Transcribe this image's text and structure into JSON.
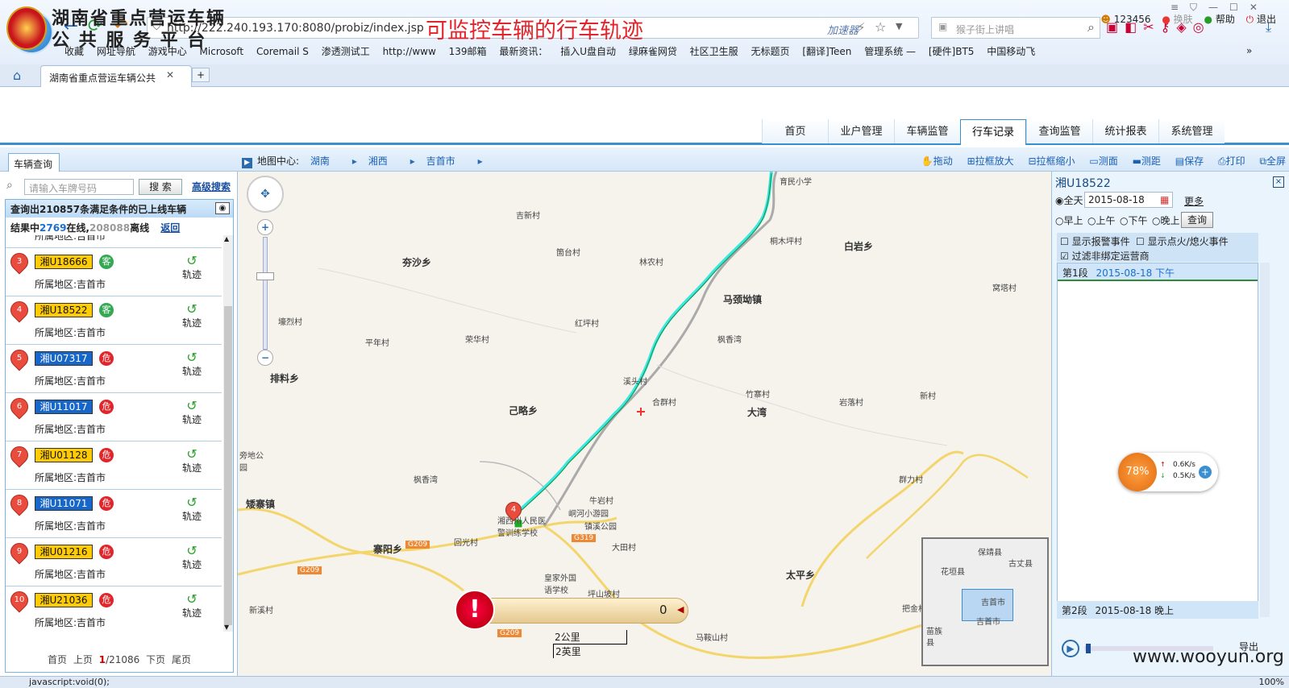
{
  "browser": {
    "url": "http://222.240.193.170:8080/probiz/index.jsp",
    "accelerator": "加速器",
    "search_placeholder": "猴子街上讲唱",
    "bookmarks": [
      "收藏",
      "网址导航",
      "游戏中心",
      "Microsoft",
      "Coremail S",
      "渗透测试工",
      "http://www",
      "139邮箱",
      "最新资讯：",
      "插入U盘自动",
      "绿麻雀网贷",
      "社区卫生服",
      "无标题页",
      "[翻译]Teen",
      "管理系统 —",
      "[硬件]BT5",
      "中国移动飞"
    ],
    "tab_title": "湖南省重点营运车辆公共"
  },
  "header": {
    "title_line1": "湖南省重点营运车辆",
    "title_line2": "公 共 服 务 平 台",
    "annotation": "可监控车辆的行车轨迹",
    "user": "123456",
    "skin": "换肤",
    "help": "帮助",
    "logout": "退出",
    "nav": [
      "首页",
      "业户管理",
      "车辆监管",
      "行车记录",
      "查询监管",
      "统计报表",
      "系统管理"
    ]
  },
  "crumbs": {
    "label": "地图中心:",
    "items": [
      "湖南",
      "湘西",
      "吉首市"
    ]
  },
  "tools": [
    "拖动",
    "拉框放大",
    "拉框缩小",
    "测面",
    "测距",
    "保存",
    "打印",
    "全屏"
  ],
  "left": {
    "tab": "车辆查询",
    "placeholder": "请输入车牌号码",
    "search_btn": "搜 索",
    "advanced": "高级搜索",
    "result_title": "查询出210857条满足条件的已上线车辆",
    "result_prefix": "结果中",
    "online": "2769",
    "online_label": "在线,",
    "offline": "208088",
    "offline_label": "离线",
    "back": "返回",
    "partial_region": "所属地区:吉首市",
    "rows": [
      {
        "n": "3",
        "plate": "湘U18666",
        "color": "yellow",
        "type": "客",
        "tcolor": "ke",
        "region": "所属地区:吉首市",
        "trk": "轨迹"
      },
      {
        "n": "4",
        "plate": "湘U18522",
        "color": "yellow",
        "type": "客",
        "tcolor": "ke",
        "region": "所属地区:吉首市",
        "trk": "轨迹"
      },
      {
        "n": "5",
        "plate": "湘U07317",
        "color": "blue",
        "type": "危",
        "tcolor": "wei",
        "region": "所属地区:吉首市",
        "trk": "轨迹"
      },
      {
        "n": "6",
        "plate": "湘U11017",
        "color": "blue",
        "type": "危",
        "tcolor": "wei",
        "region": "所属地区:吉首市",
        "trk": "轨迹"
      },
      {
        "n": "7",
        "plate": "湘U01128",
        "color": "yellow",
        "type": "危",
        "tcolor": "wei",
        "region": "所属地区:吉首市",
        "trk": "轨迹"
      },
      {
        "n": "8",
        "plate": "湘U11071",
        "color": "blue",
        "type": "危",
        "tcolor": "wei",
        "region": "所属地区:吉首市",
        "trk": "轨迹"
      },
      {
        "n": "9",
        "plate": "湘U01216",
        "color": "yellow",
        "type": "危",
        "tcolor": "wei",
        "region": "所属地区:吉首市",
        "trk": "轨迹"
      },
      {
        "n": "10",
        "plate": "湘U21036",
        "color": "yellow",
        "type": "危",
        "tcolor": "wei",
        "region": "所属地区:吉首市",
        "trk": "轨迹"
      }
    ],
    "pager": {
      "first": "首页",
      "prev": "上页",
      "current": "1",
      "total": "/21086",
      "next": "下页",
      "last": "尾页"
    }
  },
  "map": {
    "places": [
      "育民小学",
      "吉新村",
      "箇台村",
      "林农村",
      "桐木坪村",
      "白岩乡",
      "夯沙乡",
      "马颈坳镇",
      "壕烈村",
      "平年村",
      "荣华村",
      "红坪村",
      "枫香湾",
      "排料乡",
      "溪头村",
      "合群村",
      "竹寨村",
      "岩落村",
      "新村",
      "己略乡",
      "大湾",
      "旁地公园",
      "枫香湾",
      "群力村",
      "矮寨镇",
      "湘西州人民医",
      "警训练学校",
      "峒河小游园",
      "牛岩村",
      "镇溪公园",
      "回光村",
      "大田村",
      "寨阳乡",
      "皇家外国语学校",
      "坪山坡村",
      "太平乡",
      "新溪村",
      "把金村",
      "马鞍山村",
      "窝塔村"
    ],
    "roads": [
      "G209",
      "G319",
      "G209",
      "G209"
    ],
    "marker": "4",
    "alarm_count": "0",
    "scale_km": "2公里",
    "scale_mi": "2英里",
    "mini_places": [
      "保靖县",
      "古丈县",
      "花垣县",
      "吉首市",
      "吉首市",
      "苗族",
      "县"
    ]
  },
  "right": {
    "title": "湘U18522",
    "close": "×",
    "options": [
      "全天",
      "早上",
      "上午",
      "下午",
      "晚上"
    ],
    "date": "2015-08-18",
    "more": "更多",
    "query": "查询",
    "chk_alarm": "显示报警事件",
    "chk_fire": "显示点火/熄火事件",
    "chk_filter": "过滤非绑定运营商",
    "seg1_label": "第1段",
    "seg1_date": "2015-08-18 下午",
    "seg2_label": "第2段",
    "seg2_date": "2015-08-18 晚上",
    "speed_pct": "78%",
    "up": "0.6K/s",
    "down": "0.5K/s",
    "export": "导出"
  },
  "status": {
    "text": "javascript:void(0);",
    "zoom": "100%"
  },
  "watermark": "www.wooyun.org"
}
